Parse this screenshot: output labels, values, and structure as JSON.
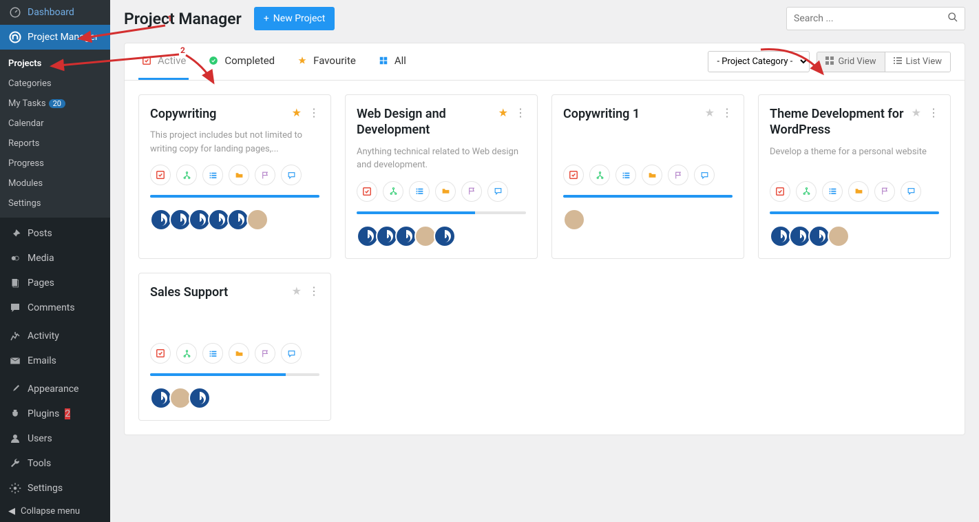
{
  "sidebar": {
    "main": [
      {
        "label": "Dashboard",
        "icon": "dashboard"
      },
      {
        "label": "Project Manager",
        "icon": "pm",
        "active": true
      }
    ],
    "submenu": [
      {
        "label": "Projects",
        "active": true
      },
      {
        "label": "Categories"
      },
      {
        "label": "My Tasks",
        "badge": "20"
      },
      {
        "label": "Calendar"
      },
      {
        "label": "Reports"
      },
      {
        "label": "Progress"
      },
      {
        "label": "Modules"
      },
      {
        "label": "Settings"
      }
    ],
    "rest": [
      {
        "label": "Posts",
        "icon": "pin"
      },
      {
        "label": "Media",
        "icon": "media"
      },
      {
        "label": "Pages",
        "icon": "pages"
      },
      {
        "label": "Comments",
        "icon": "comment"
      },
      {
        "sep": true
      },
      {
        "label": "Activity",
        "icon": "activity"
      },
      {
        "label": "Emails",
        "icon": "mail"
      },
      {
        "sep": true
      },
      {
        "label": "Appearance",
        "icon": "brush"
      },
      {
        "label": "Plugins",
        "icon": "plug",
        "badge": "2",
        "badgeRed": true
      },
      {
        "label": "Users",
        "icon": "user"
      },
      {
        "label": "Tools",
        "icon": "wrench"
      },
      {
        "label": "Settings",
        "icon": "gear"
      }
    ],
    "collapse": "Collapse menu"
  },
  "header": {
    "title": "Project Manager",
    "new_project": "New Project",
    "search_placeholder": "Search ..."
  },
  "tabs": [
    {
      "label": "Active",
      "icon": "check-sq",
      "color": "#e74c3c",
      "active": true
    },
    {
      "label": "Completed",
      "icon": "check-circ",
      "color": "#2ecc71"
    },
    {
      "label": "Favourite",
      "icon": "star",
      "color": "#f5a623"
    },
    {
      "label": "All",
      "icon": "grid",
      "color": "#2196f3"
    }
  ],
  "category_select": "- Project Category -",
  "view": {
    "grid": "Grid View",
    "list": "List View"
  },
  "card_icons": [
    "check-sq",
    "tree",
    "list",
    "folder",
    "flag",
    "chat"
  ],
  "card_icon_colors": [
    "#e74c3c",
    "#2ecc71",
    "#2196f3",
    "#f5a623",
    "#b07cc6",
    "#2196f3"
  ],
  "projects": [
    {
      "title": "Copywriting",
      "fav": true,
      "desc": "This project includes but not limited to writing copy for landing pages,...",
      "progress": 100,
      "avatars": [
        "g",
        "g",
        "g",
        "g",
        "g",
        "p"
      ]
    },
    {
      "title": "Web Design and Development",
      "fav": true,
      "desc": "Anything technical related to Web design and development.",
      "progress": 70,
      "avatars": [
        "g",
        "g",
        "g",
        "p",
        "g"
      ]
    },
    {
      "title": "Copywriting 1",
      "fav": false,
      "desc": "",
      "progress": 100,
      "avatars": [
        "p"
      ]
    },
    {
      "title": "Theme Development for WordPress",
      "fav": false,
      "desc": "Develop a theme for a personal website",
      "progress": 100,
      "avatars": [
        "g",
        "g",
        "g",
        "p"
      ]
    },
    {
      "title": "Sales Support",
      "fav": false,
      "desc": "",
      "progress": 80,
      "avatars": [
        "g",
        "p",
        "g"
      ]
    }
  ],
  "annotations": {
    "n1": "1",
    "n2": "2"
  }
}
